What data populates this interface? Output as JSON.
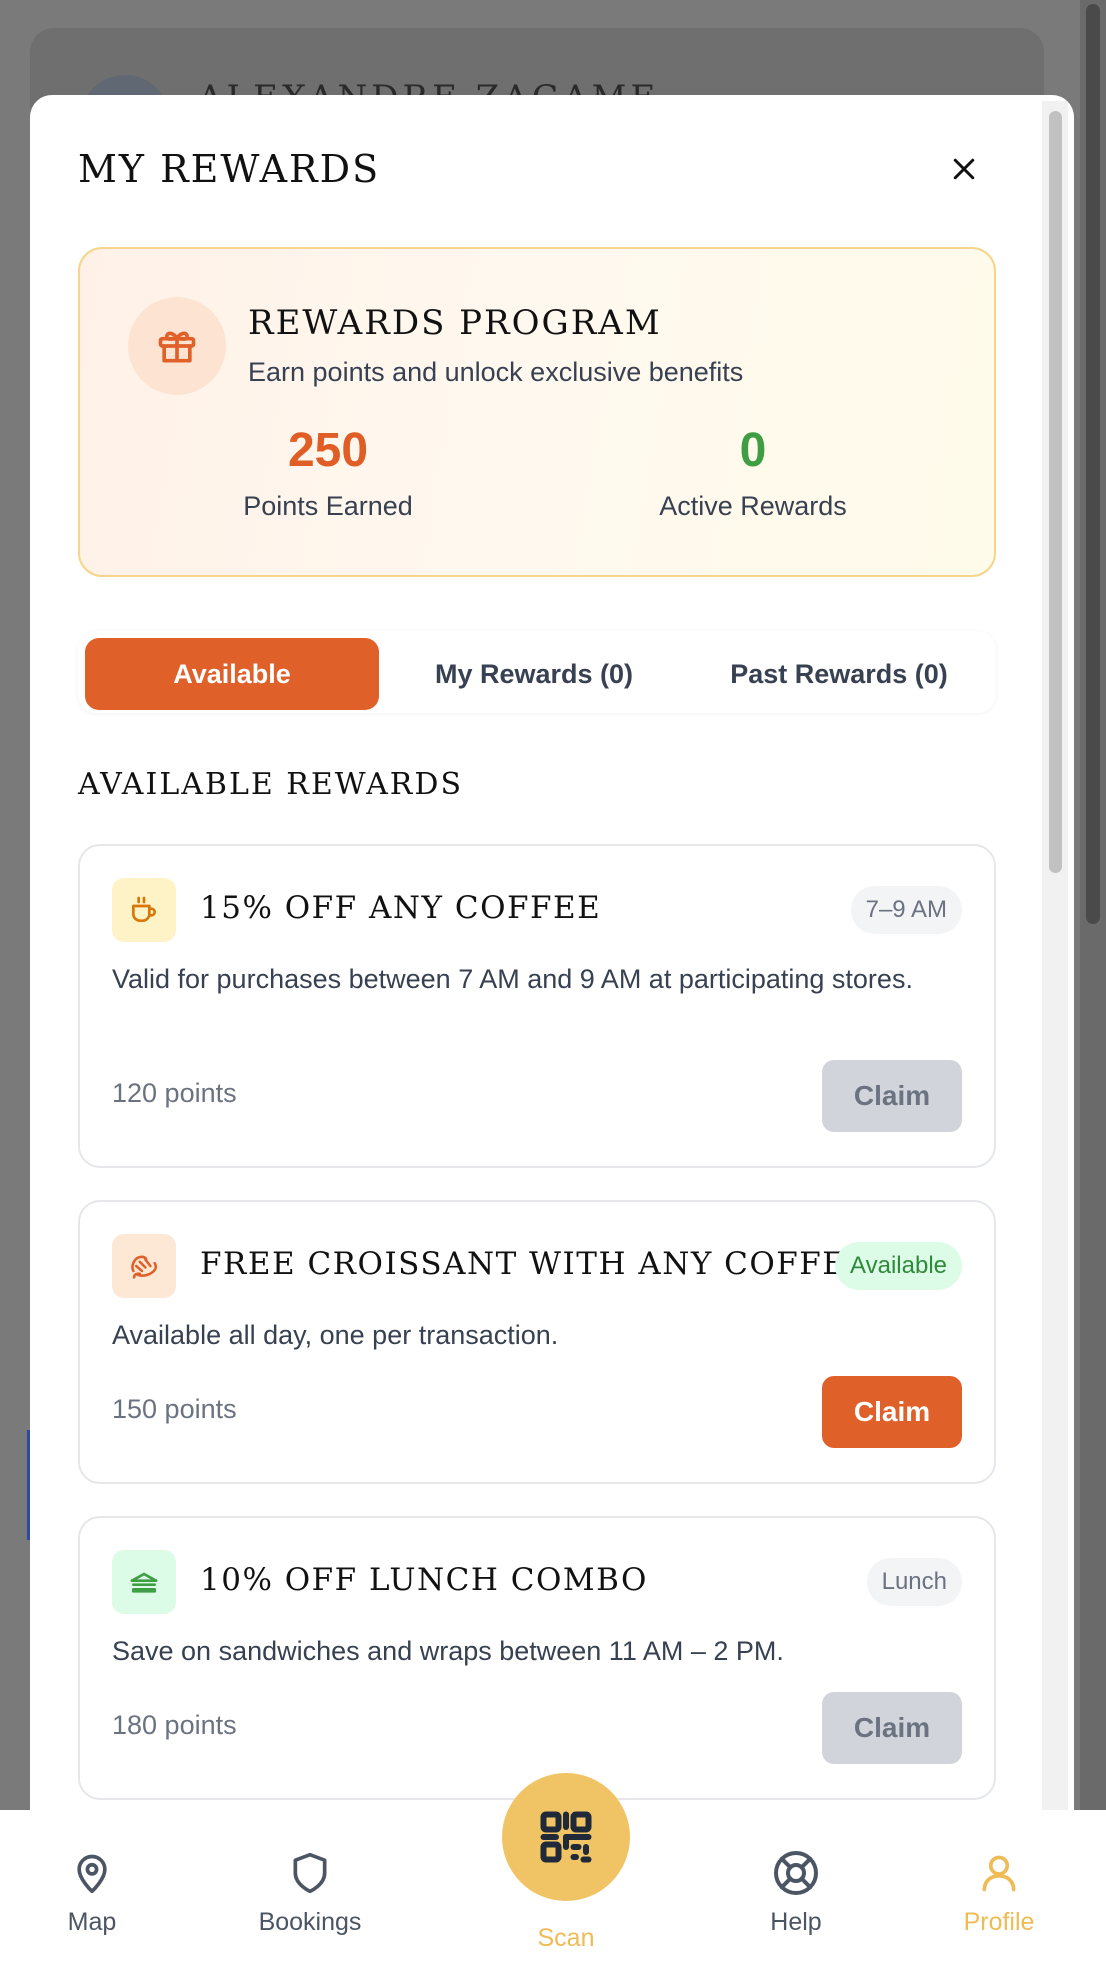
{
  "background": {
    "user_name": "ALEXANDRE ZAGAME"
  },
  "modal": {
    "title": "MY REWARDS",
    "program": {
      "title": "REWARDS PROGRAM",
      "subtitle": "Earn points and unlock exclusive benefits",
      "points_value": "250",
      "points_label": "Points Earned",
      "active_value": "0",
      "active_label": "Active Rewards"
    },
    "tabs": [
      {
        "label": "Available",
        "active": true
      },
      {
        "label": "My Rewards (0)",
        "active": false
      },
      {
        "label": "Past Rewards (0)",
        "active": false
      }
    ],
    "section_title": "AVAILABLE REWARDS",
    "rewards": [
      {
        "icon": "coffee-cup-icon",
        "title": "15% OFF ANY COFFEE",
        "badge": "7–9 AM",
        "description": "Valid for purchases between 7 AM and 9 AM at participating stores.",
        "points": "120 points",
        "claim_label": "Claim",
        "claim_enabled": false
      },
      {
        "icon": "croissant-icon",
        "title": "FREE CROISSANT WITH ANY COFFEE",
        "badge": "Available",
        "description": "Available all day, one per transaction.",
        "points": "150 points",
        "claim_label": "Claim",
        "claim_enabled": true
      },
      {
        "icon": "sandwich-icon",
        "title": "10% OFF LUNCH COMBO",
        "badge": "Lunch",
        "description": "Save on sandwiches and wraps between 11 AM – 2 PM.",
        "points": "180 points",
        "claim_label": "Claim",
        "claim_enabled": false
      }
    ]
  },
  "nav": {
    "map": "Map",
    "bookings": "Bookings",
    "scan": "Scan",
    "help": "Help",
    "profile": "Profile",
    "active": "profile"
  },
  "colors": {
    "accent_orange": "#e0602a",
    "accent_gold": "#f0c464",
    "success_green": "#3f9d43"
  }
}
